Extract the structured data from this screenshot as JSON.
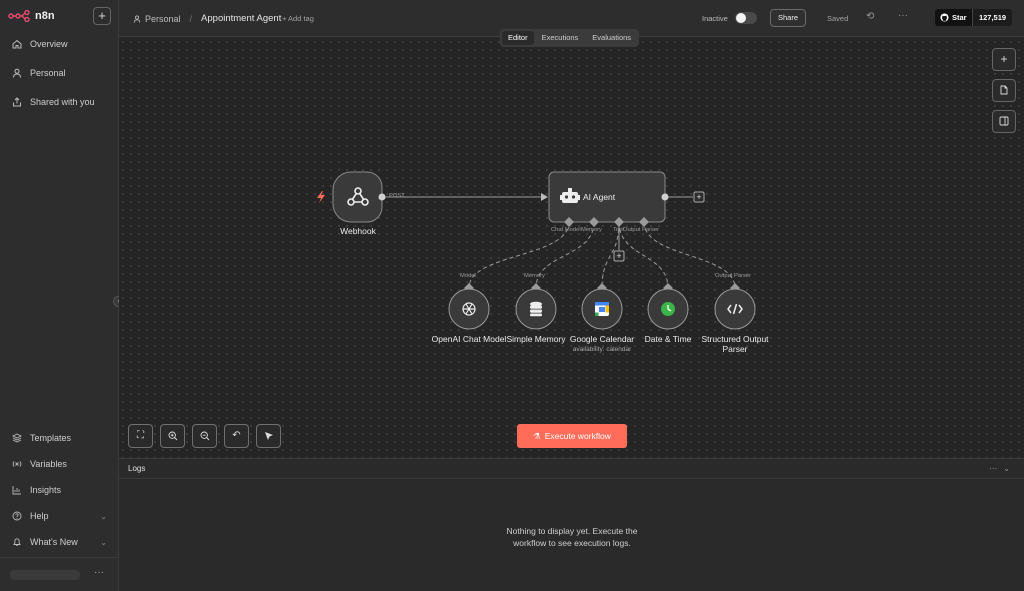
{
  "app": {
    "name": "n8n"
  },
  "sidebar": {
    "items": [
      {
        "label": "Overview",
        "icon": "home-icon"
      },
      {
        "label": "Personal",
        "icon": "user-icon"
      },
      {
        "label": "Shared with you",
        "icon": "share-icon"
      }
    ],
    "bottom_items": [
      {
        "label": "Templates",
        "icon": "templates-icon"
      },
      {
        "label": "Variables",
        "icon": "variables-icon"
      },
      {
        "label": "Insights",
        "icon": "insights-icon"
      },
      {
        "label": "Help",
        "icon": "help-icon"
      },
      {
        "label": "What's New",
        "icon": "bell-icon"
      }
    ]
  },
  "topbar": {
    "breadcrumb_project": "Personal",
    "separator": "/",
    "workflow_name": "Appointment Agent",
    "add_tag": "+ Add tag",
    "status_label": "Inactive",
    "share_label": "Share",
    "saved_label": "Saved",
    "github_star": "Star",
    "github_count": "127,519"
  },
  "tabs": [
    {
      "label": "Editor",
      "active": true
    },
    {
      "label": "Executions",
      "active": false
    },
    {
      "label": "Evaluations",
      "active": false
    }
  ],
  "nodes": {
    "webhook": {
      "label": "Webhook",
      "port_label": "POST"
    },
    "agent": {
      "label": "AI Agent",
      "ports": [
        "Chat Model",
        "Memory",
        "Tool",
        "Output Parser"
      ]
    },
    "subnodes": [
      {
        "label": "OpenAI Chat Model",
        "port": "Model",
        "sub": "",
        "icon": "openai-icon"
      },
      {
        "label": "Simple Memory",
        "port": "Memory",
        "sub": "",
        "icon": "database-icon"
      },
      {
        "label": "Google Calendar",
        "port": "",
        "sub": "availability: calendar",
        "icon": "google-calendar-icon"
      },
      {
        "label": "Date & Time",
        "port": "",
        "sub": "",
        "icon": "clock-icon"
      },
      {
        "label": "Structured Output Parser",
        "port": "Output Parser",
        "sub": "",
        "icon": "code-icon"
      }
    ]
  },
  "canvas": {
    "execute_label": "Execute workflow"
  },
  "logs": {
    "title": "Logs",
    "empty_message": "Nothing to display yet. Execute the workflow to see execution logs."
  },
  "colors": {
    "accent": "#ff6d5a",
    "canvas_bg": "#252525",
    "sidebar_bg": "#2d2d2d",
    "calendar_green": "#3bb54a"
  }
}
